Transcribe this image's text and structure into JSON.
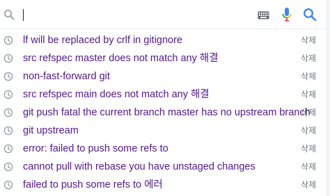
{
  "search": {
    "value": "",
    "icons": {
      "lead": "search-icon",
      "keyboard": "keyboard-icon",
      "voice": "mic-icon",
      "submit": "search-icon"
    }
  },
  "colors": {
    "visited_link": "#52188c",
    "muted": "#70757a",
    "google_blue": "#4285f4",
    "google_red": "#ea4335",
    "google_yellow": "#fbbc04",
    "google_green": "#34a853"
  },
  "suggestions": [
    {
      "text": "lf will be replaced by crlf in gitignore",
      "delete_label": "삭제",
      "icon": "history-icon"
    },
    {
      "text": "src refspec master does not match any 해결",
      "delete_label": "삭제",
      "icon": "history-icon"
    },
    {
      "text": "non-fast-forward git",
      "delete_label": "삭제",
      "icon": "history-icon"
    },
    {
      "text": "src refspec main does not match any 해결",
      "delete_label": "삭제",
      "icon": "history-icon"
    },
    {
      "text": "git push fatal the current branch master has no upstream branch",
      "delete_label": "삭제",
      "icon": "history-icon"
    },
    {
      "text": "git upstream",
      "delete_label": "삭제",
      "icon": "history-icon"
    },
    {
      "text": "error: failed to push some refs to",
      "delete_label": "삭제",
      "icon": "history-icon"
    },
    {
      "text": "cannot pull with rebase you have unstaged changes",
      "delete_label": "삭제",
      "icon": "history-icon"
    },
    {
      "text": "failed to push some refs to 에러",
      "delete_label": "삭제",
      "icon": "history-icon"
    }
  ]
}
